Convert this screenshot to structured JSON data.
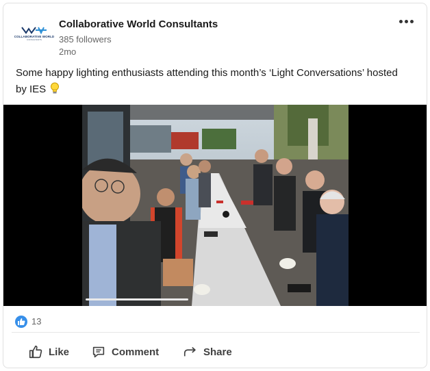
{
  "post": {
    "company_name": "Collaborative World Consultants",
    "followers": "385 followers",
    "time": "2mo",
    "logo": {
      "text": "COLLABORATIVE WORLD",
      "sub": "CONSULTANTS",
      "mark": "CWC-logo"
    },
    "text": "Some happy lighting enthusiasts attending this month’s ‘Light Conversations’ hosted by IES",
    "emoji": "light-bulb-icon"
  },
  "reactions": {
    "count": "13",
    "icon": "like-icon"
  },
  "actions": {
    "like": "Like",
    "comment": "Comment",
    "share": "Share"
  },
  "colors": {
    "accent": "#378fe9",
    "text": "#191919",
    "muted": "#666666"
  }
}
